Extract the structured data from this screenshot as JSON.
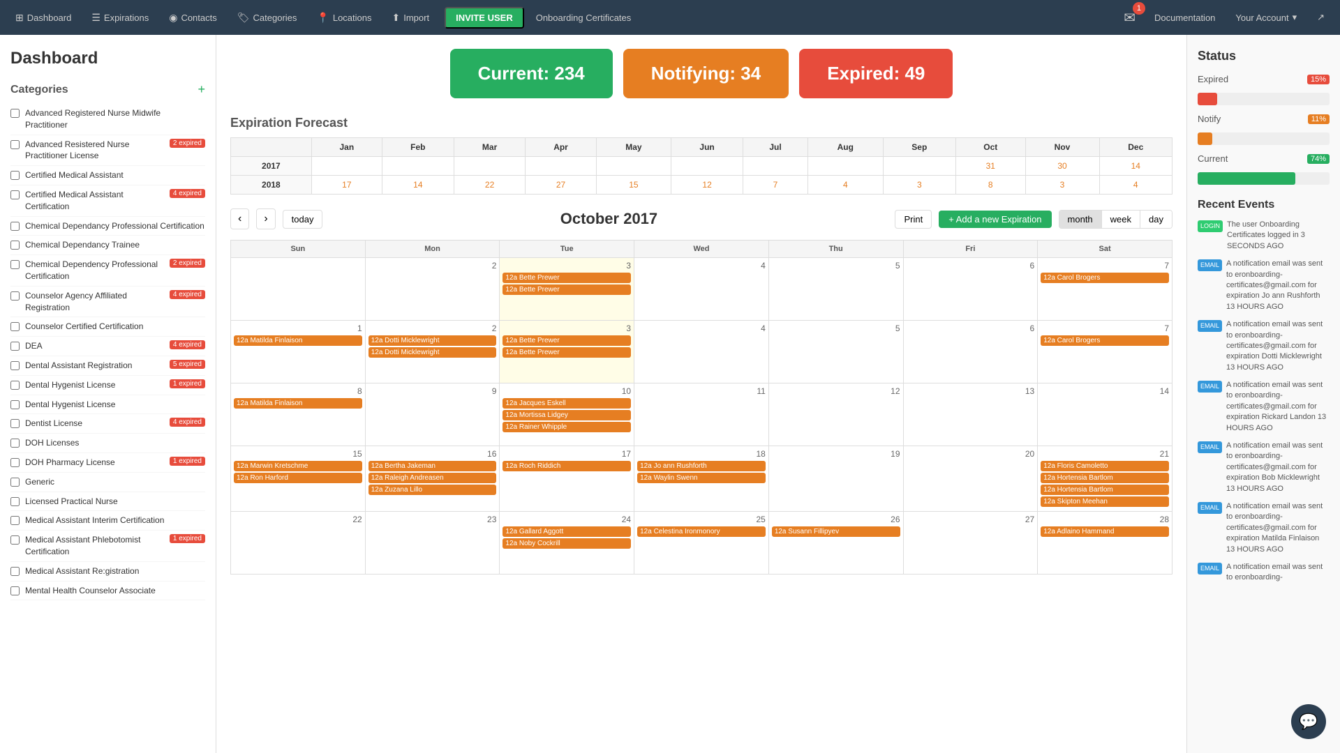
{
  "nav": {
    "items": [
      {
        "label": "Dashboard",
        "icon": "⊞",
        "name": "dashboard"
      },
      {
        "label": "Expirations",
        "icon": "☰",
        "name": "expirations"
      },
      {
        "label": "Contacts",
        "icon": "◉",
        "name": "contacts"
      },
      {
        "label": "Categories",
        "icon": "🏷",
        "name": "categories"
      },
      {
        "label": "Locations",
        "icon": "📍",
        "name": "locations"
      },
      {
        "label": "Import",
        "icon": "⬆",
        "name": "import"
      }
    ],
    "invite_label": "INVITE USER",
    "onboarding_label": "Onboarding Certificates",
    "documentation_label": "Documentation",
    "account_label": "Your Account",
    "notification_count": "1"
  },
  "sidebar": {
    "title": "Dashboard",
    "categories_title": "Categories",
    "add_icon": "+",
    "items": [
      {
        "name": "Advanced Registered Nurse Midwife Practitioner",
        "badge": null
      },
      {
        "name": "Advanced Resistered Nurse Practitioner License",
        "badge": "2 expired",
        "badge_type": "expired"
      },
      {
        "name": "Certified Medical Assistant",
        "badge": null
      },
      {
        "name": "Certified Medical Assistant Certification",
        "badge": "4 expired",
        "badge_type": "expired"
      },
      {
        "name": "Chemical Dependancy Professional Certification",
        "badge": null
      },
      {
        "name": "Chemical Dependancy Trainee",
        "badge": null
      },
      {
        "name": "Chemical Dependency Professional Certification",
        "badge": "2 expired",
        "badge_type": "expired"
      },
      {
        "name": "Counselor Agency Affiliated Registration",
        "badge": "4 expired",
        "badge_type": "expired"
      },
      {
        "name": "Counselor Certified Certification",
        "badge": null
      },
      {
        "name": "DEA",
        "badge": "4 expired",
        "badge_type": "expired"
      },
      {
        "name": "Dental Assistant Registration",
        "badge": "5 expired",
        "badge_type": "expired"
      },
      {
        "name": "Dental Hygenist License",
        "badge": "1 expired",
        "badge_type": "expired"
      },
      {
        "name": "Dental Hygenist License",
        "badge": null
      },
      {
        "name": "Dentist License",
        "badge": "4 expired",
        "badge_type": "expired"
      },
      {
        "name": "DOH Licenses",
        "badge": null
      },
      {
        "name": "DOH Pharmacy License",
        "badge": "1 expired",
        "badge_type": "expired"
      },
      {
        "name": "Generic",
        "badge": null
      },
      {
        "name": "Licensed Practical Nurse",
        "badge": null
      },
      {
        "name": "Medical Assistant Interim Certification",
        "badge": null
      },
      {
        "name": "Medical Assistant Phlebotomist Certification",
        "badge": "1 expired",
        "badge_type": "expired"
      },
      {
        "name": "Medical Assistant Re:gistration",
        "badge": null
      },
      {
        "name": "Mental Health Counselor Associate",
        "badge": null
      }
    ]
  },
  "status_cards": {
    "current_label": "Current: 234",
    "notifying_label": "Notifying: 34",
    "expired_label": "Expired: 49"
  },
  "forecast": {
    "title": "Expiration Forecast",
    "months": [
      "Jan",
      "Feb",
      "Mar",
      "Apr",
      "May",
      "Jun",
      "Jul",
      "Aug",
      "Sep",
      "Oct",
      "Nov",
      "Dec"
    ],
    "rows": [
      {
        "year": "2017",
        "values": [
          "",
          "",
          "",
          "",
          "",
          "",
          "",
          "",
          "",
          "31",
          "30",
          "14"
        ]
      },
      {
        "year": "2018",
        "values": [
          "17",
          "14",
          "22",
          "27",
          "15",
          "12",
          "7",
          "4",
          "3",
          "8",
          "3",
          "4"
        ]
      }
    ]
  },
  "calendar": {
    "title": "October 2017",
    "today_label": "today",
    "print_label": "Print",
    "add_label": "+ Add a new Expiration",
    "view_month": "month",
    "view_week": "week",
    "view_day": "day",
    "days": [
      "Sun",
      "Mon",
      "Tue",
      "Wed",
      "Thu",
      "Fri",
      "Sat"
    ],
    "weeks": [
      [
        {
          "day": "",
          "events": []
        },
        {
          "day": "2",
          "events": []
        },
        {
          "day": "3",
          "events": [
            {
              "label": "12a Bette Prewer",
              "color": "orange"
            },
            {
              "label": "12a Bette Prewer",
              "color": "orange"
            }
          ],
          "today": true
        },
        {
          "day": "4",
          "events": []
        },
        {
          "day": "5",
          "events": []
        },
        {
          "day": "6",
          "events": []
        },
        {
          "day": "7",
          "events": [
            {
              "label": "12a Carol Brogers",
              "color": "orange"
            }
          ]
        }
      ],
      [
        {
          "day": "1",
          "events": [
            {
              "label": "12a Matilda Finlaison",
              "color": "orange"
            }
          ]
        },
        {
          "day": "2",
          "events": [
            {
              "label": "12a Dotti Micklewright",
              "color": "orange"
            },
            {
              "label": "12a Dotti Micklewright",
              "color": "orange"
            }
          ]
        },
        {
          "day": "3",
          "events": [
            {
              "label": "12a Bette Prewer",
              "color": "orange"
            },
            {
              "label": "12a Bette Prewer",
              "color": "orange"
            }
          ],
          "today": true
        },
        {
          "day": "4",
          "events": []
        },
        {
          "day": "5",
          "events": []
        },
        {
          "day": "6",
          "events": []
        },
        {
          "day": "7",
          "events": [
            {
              "label": "12a Carol Brogers",
              "color": "orange"
            }
          ]
        }
      ],
      [
        {
          "day": "8",
          "events": [
            {
              "label": "12a Matilda Finlaison",
              "color": "orange"
            }
          ]
        },
        {
          "day": "9",
          "events": []
        },
        {
          "day": "10",
          "events": [
            {
              "label": "12a Jacques Eskell",
              "color": "orange"
            },
            {
              "label": "12a Mortissa Lidgey",
              "color": "orange"
            },
            {
              "label": "12a Rainer Whipple",
              "color": "orange"
            }
          ]
        },
        {
          "day": "11",
          "events": []
        },
        {
          "day": "12",
          "events": []
        },
        {
          "day": "13",
          "events": []
        },
        {
          "day": "14",
          "events": []
        }
      ],
      [
        {
          "day": "15",
          "events": [
            {
              "label": "12a Marwin Kretschme",
              "color": "orange"
            },
            {
              "label": "12a Ron Harford",
              "color": "orange"
            }
          ]
        },
        {
          "day": "16",
          "events": [
            {
              "label": "12a Bertha Jakeman",
              "color": "orange"
            },
            {
              "label": "12a Raleigh Andreasen",
              "color": "orange"
            },
            {
              "label": "12a Zuzana Lillo",
              "color": "orange"
            }
          ]
        },
        {
          "day": "17",
          "events": [
            {
              "label": "12a Roch Riddich",
              "color": "orange"
            }
          ]
        },
        {
          "day": "18",
          "events": [
            {
              "label": "12a Jo ann Rushforth",
              "color": "orange"
            },
            {
              "label": "12a Waylin Swenn",
              "color": "orange"
            }
          ]
        },
        {
          "day": "19",
          "events": []
        },
        {
          "day": "20",
          "events": []
        },
        {
          "day": "21",
          "events": [
            {
              "label": "12a Floris Camoletto",
              "color": "orange"
            },
            {
              "label": "12a Hortensia Bartlom",
              "color": "orange"
            },
            {
              "label": "12a Hortensia Bartlom",
              "color": "orange"
            },
            {
              "label": "12a Skipton Meehan",
              "color": "orange"
            }
          ]
        }
      ],
      [
        {
          "day": "22",
          "events": []
        },
        {
          "day": "23",
          "events": []
        },
        {
          "day": "24",
          "events": [
            {
              "label": "12a Gallard Aggott",
              "color": "orange"
            },
            {
              "label": "12a Noby Cockrill",
              "color": "orange"
            }
          ]
        },
        {
          "day": "25",
          "events": [
            {
              "label": "12a Celestina Ironmonory",
              "color": "orange"
            }
          ]
        },
        {
          "day": "26",
          "events": [
            {
              "label": "12a Susann Fillipyev",
              "color": "orange"
            }
          ]
        },
        {
          "day": "27",
          "events": []
        },
        {
          "day": "28",
          "events": [
            {
              "label": "12a Adlaino Hammand",
              "color": "orange"
            }
          ]
        }
      ]
    ]
  },
  "status_panel": {
    "title": "Status",
    "expired_label": "Expired",
    "expired_pct": "15%",
    "expired_bar": 15,
    "notify_label": "Notify",
    "notify_pct": "11%",
    "notify_bar": 11,
    "current_label": "Current",
    "current_pct": "74%",
    "current_bar": 74
  },
  "recent_events": {
    "title": "Recent Events",
    "items": [
      {
        "type": "LOGIN",
        "text": "The user Onboarding Certificates logged in  3 SECONDS AGO"
      },
      {
        "type": "EMAIL",
        "text": "A notification email was sent to eronboarding-certificates@gmail.com for expiration Jo ann Rushforth  13 HOURS AGO"
      },
      {
        "type": "EMAIL",
        "text": "A notification email was sent to eronboarding-certificates@gmail.com for expiration Dotti Micklewright  13 HOURS AGO"
      },
      {
        "type": "EMAIL",
        "text": "A notification email was sent to eronboarding-certificates@gmail.com for expiration Rickard Landon  13 HOURS AGO"
      },
      {
        "type": "EMAIL",
        "text": "A notification email was sent to eronboarding-certificates@gmail.com for expiration Bob Micklewright  13 HOURS AGO"
      },
      {
        "type": "EMAIL",
        "text": "A notification email was sent to eronboarding-certificates@gmail.com for expiration Matilda Finlaison  13 HOURS AGO"
      },
      {
        "type": "EMAIL",
        "text": "A notification email was sent to eronboarding-"
      }
    ]
  }
}
